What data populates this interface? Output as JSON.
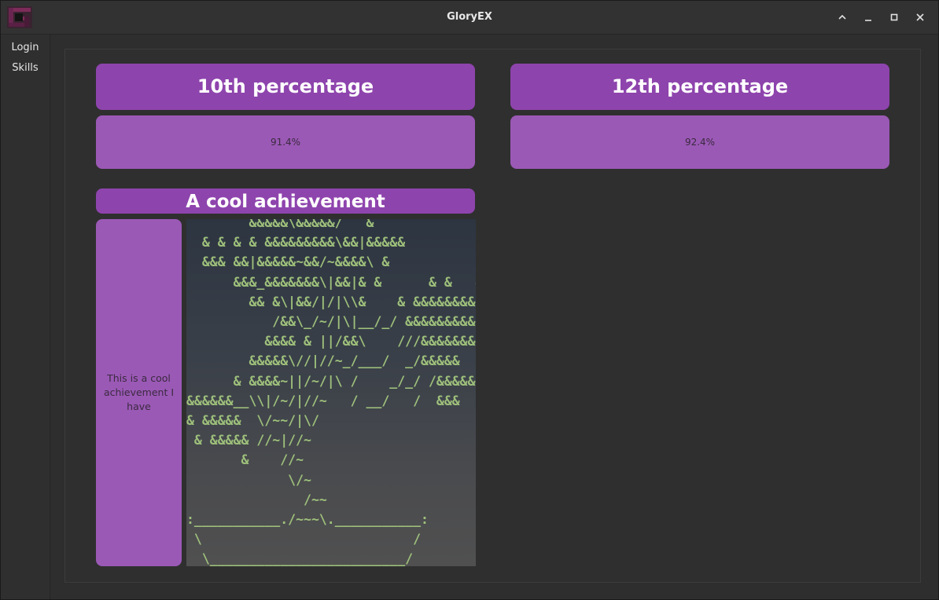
{
  "window": {
    "title": "GloryEX",
    "controls": [
      "chevron-up-icon",
      "minimize-icon",
      "maximize-icon",
      "close-icon"
    ]
  },
  "sidebar": {
    "items": [
      {
        "label": "Login"
      },
      {
        "label": "Skills"
      }
    ]
  },
  "cards": {
    "tenth": {
      "title": "10th percentage",
      "value": "91.4%"
    },
    "twelfth": {
      "title": "12th percentage",
      "value": "92.4%"
    },
    "achievement": {
      "title": "A cool achievement",
      "description": "This is a cool achievement I have"
    }
  },
  "ascii_art": "        &&&&&\\&&&&&/   &\n  & & & & &&&&&&&&&\\&&|&&&&&\n  &&& &&|&&&&&~&&/~&&&&\\ &\n      &&&_&&&&&&&\\|&&|& &      & &   &\n        && &\\|&&/|/|\\\\&    & &&&&&&&&\n           /&&\\_/~/|\\|__/_/ &&&&&&&&&\n          &&&& & ||/&&\\    ///&&&&&&&&\n        &&&&&\\//|//~_/___/  _/&&&&&\n      & &&&&~||/~/|\\ /    _/_/ /&&&&&\n&&&&&&__\\\\|/~/|//~   / __/   /  &&&\n& &&&&&  \\/~~/|\\/\n & &&&&& //~|//~\n       &    //~\n             \\/~\n               /~~\n:___________./~~~\\.___________:\n \\                           /\n  \\_________________________/\n  (_)                     (_)",
  "colors": {
    "card_header": "#8e44ad",
    "card_body": "#9b59b6",
    "background": "#2e2e2e",
    "ascii_green": "#9ec07b",
    "ascii_orange": "#e8b86a"
  }
}
